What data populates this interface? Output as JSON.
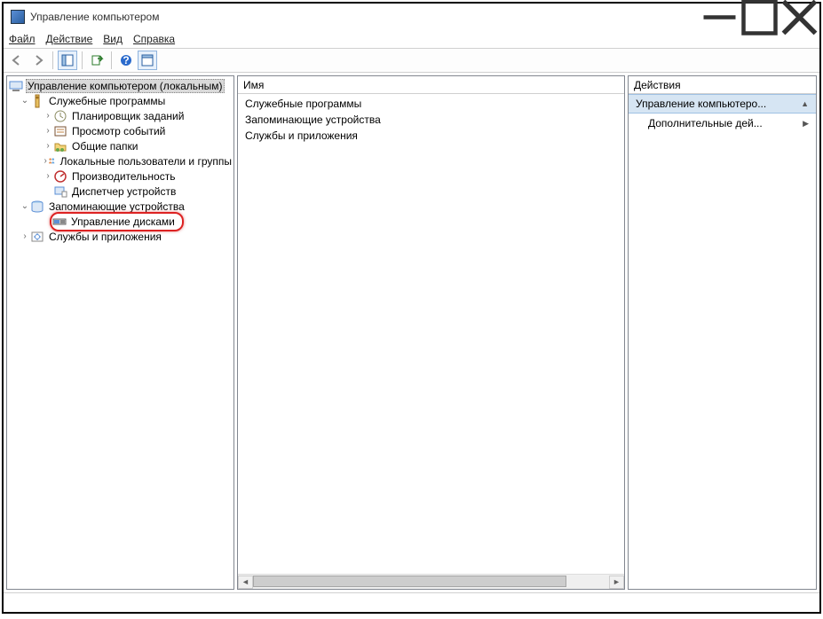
{
  "title": "Управление компьютером",
  "menus": {
    "file": "Файл",
    "action": "Действие",
    "view": "Вид",
    "help": "Справка"
  },
  "tree": {
    "root": "Управление компьютером (локальным)",
    "tools": "Служебные программы",
    "tools_items": {
      "scheduler": "Планировщик заданий",
      "eventviewer": "Просмотр событий",
      "shared": "Общие папки",
      "users": "Локальные пользователи и группы",
      "perf": "Производительность",
      "devmgr": "Диспетчер устройств"
    },
    "storage": "Запоминающие устройства",
    "diskmgmt": "Управление дисками",
    "services": "Службы и приложения"
  },
  "main": {
    "header": "Имя",
    "items": {
      "tools": "Служебные программы",
      "storage": "Запоминающие устройства",
      "services": "Службы и приложения"
    }
  },
  "actions": {
    "header": "Действия",
    "row1": "Управление компьютеро...",
    "row2": "Дополнительные дей..."
  }
}
